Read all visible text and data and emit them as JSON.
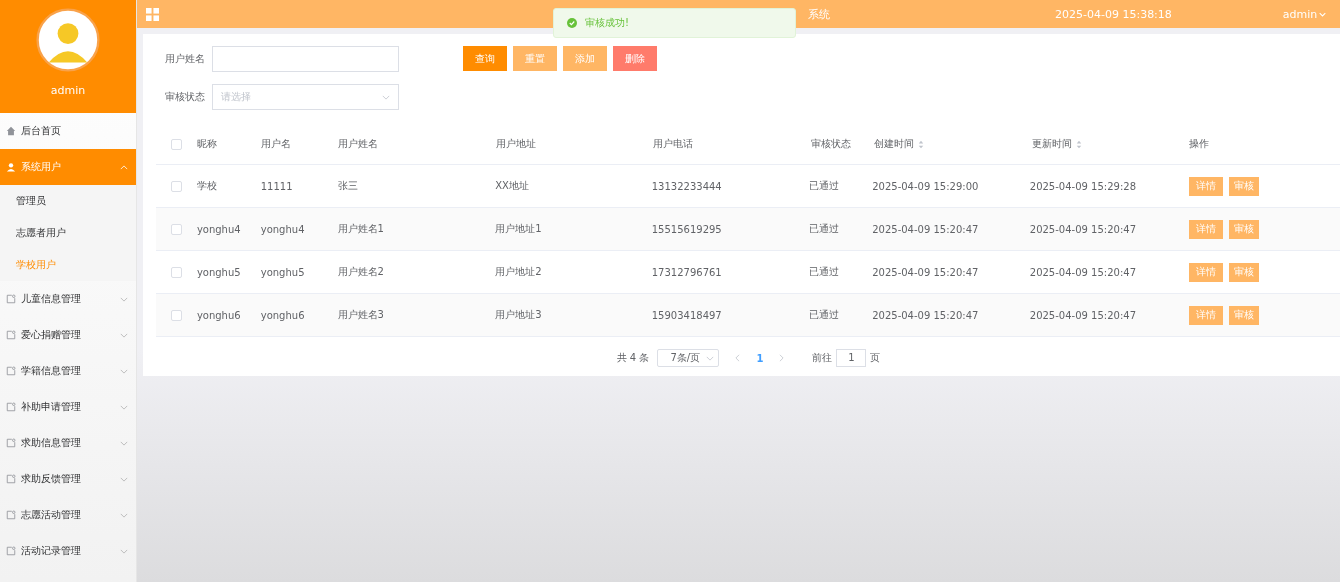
{
  "sidebar": {
    "user": "admin",
    "items": [
      {
        "label": "后台首页",
        "kind": "home",
        "selected": false
      },
      {
        "label": "系统用户",
        "kind": "user",
        "expanded": true,
        "selected": true,
        "children": [
          {
            "label": "管理员",
            "selected": false
          },
          {
            "label": "志愿者用户",
            "selected": false
          },
          {
            "label": "学校用户",
            "selected": true
          }
        ]
      },
      {
        "label": "儿童信息管理",
        "kind": "group",
        "expanded": false,
        "selected": false
      },
      {
        "label": "爱心捐赠管理",
        "kind": "group",
        "expanded": false,
        "selected": false
      },
      {
        "label": "学籍信息管理",
        "kind": "group",
        "expanded": false,
        "selected": false
      },
      {
        "label": "补助申请管理",
        "kind": "group",
        "expanded": false,
        "selected": false
      },
      {
        "label": "求助信息管理",
        "kind": "group",
        "expanded": false,
        "selected": false
      },
      {
        "label": "求助反馈管理",
        "kind": "group",
        "expanded": false,
        "selected": false
      },
      {
        "label": "志愿活动管理",
        "kind": "group",
        "expanded": false,
        "selected": false
      },
      {
        "label": "活动记录管理",
        "kind": "group",
        "expanded": false,
        "selected": false
      }
    ]
  },
  "header": {
    "title_fragment": "系统",
    "datetime": "2025-04-09 15:38:18",
    "user": "admin"
  },
  "toast": {
    "message": "审核成功!"
  },
  "search": {
    "fields": [
      {
        "label": "用户姓名",
        "kind": "input"
      },
      {
        "label": "审核状态",
        "kind": "select",
        "placeholder": "请选择"
      }
    ],
    "buttons": [
      {
        "label": "查询",
        "color": "#ff8c00"
      },
      {
        "label": "重置",
        "color": "#ffb664"
      },
      {
        "label": "添加",
        "color": "#ffb664"
      },
      {
        "label": "删除",
        "color": "#ff7b6b"
      }
    ]
  },
  "table": {
    "all_checked": false,
    "columns": [
      {
        "label": "昵称",
        "sortable": false
      },
      {
        "label": "用户名",
        "sortable": false
      },
      {
        "label": "用户姓名",
        "sortable": false
      },
      {
        "label": "用户地址",
        "sortable": false
      },
      {
        "label": "用户电话",
        "sortable": false
      },
      {
        "label": "审核状态",
        "sortable": false
      },
      {
        "label": "创建时间",
        "sortable": true
      },
      {
        "label": "更新时间",
        "sortable": true
      },
      {
        "label": "操作",
        "sortable": false
      }
    ],
    "rows": [
      {
        "checked": false,
        "cells": [
          "学校",
          "11111",
          "张三",
          "XX地址",
          "13132233444",
          "已通过",
          "2025-04-09 15:29:00",
          "2025-04-09 15:29:28"
        ],
        "actions": [
          "详情",
          "审核"
        ]
      },
      {
        "checked": false,
        "cells": [
          "yonghu4",
          "yonghu4",
          "用户姓名1",
          "用户地址1",
          "15515619295",
          "已通过",
          "2025-04-09 15:20:47",
          "2025-04-09 15:20:47"
        ],
        "actions": [
          "详情",
          "审核"
        ]
      },
      {
        "checked": false,
        "cells": [
          "yonghu5",
          "yonghu5",
          "用户姓名2",
          "用户地址2",
          "17312796761",
          "已通过",
          "2025-04-09 15:20:47",
          "2025-04-09 15:20:47"
        ],
        "actions": [
          "详情",
          "审核"
        ]
      },
      {
        "checked": false,
        "cells": [
          "yonghu6",
          "yonghu6",
          "用户姓名3",
          "用户地址3",
          "15903418497",
          "已通过",
          "2025-04-09 15:20:47",
          "2025-04-09 15:20:47"
        ],
        "actions": [
          "详情",
          "审核"
        ]
      }
    ]
  },
  "pagination": {
    "total": "共 4 条",
    "page_size": "7条/页",
    "pages": [
      {
        "label": "1",
        "selected": true
      }
    ],
    "goto_label": "前往",
    "goto_value": "1",
    "goto_suffix": "页"
  }
}
